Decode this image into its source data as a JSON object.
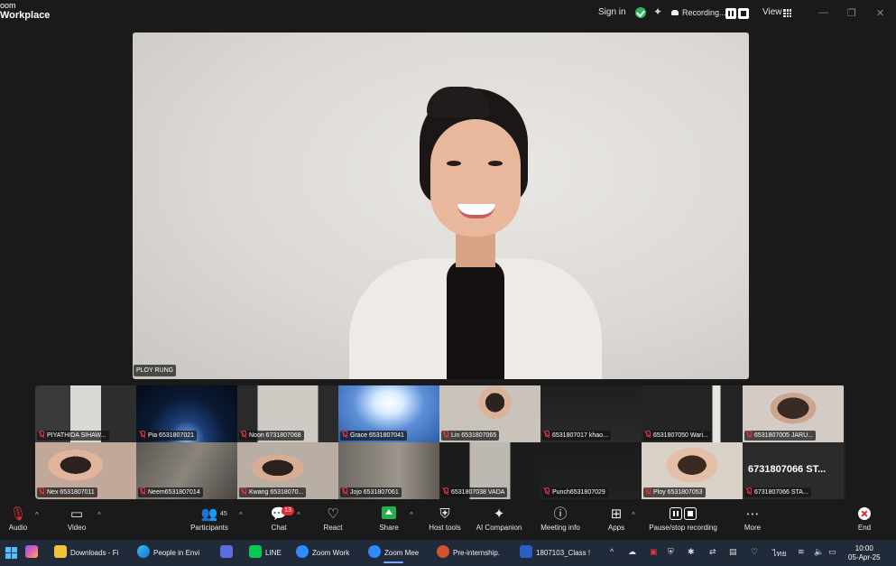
{
  "app": {
    "brand_line1": "oom",
    "brand_line2": "Workplace",
    "sign_in": "Sign in",
    "recording_label": "Recording...",
    "view_label": "View",
    "minimize": "—",
    "restore": "❐",
    "close": "✕"
  },
  "main_video": {
    "participant_name": "PLOY RUNG"
  },
  "thumbnails": [
    "PIYATHIDA SIHAW...",
    "Pia 6531807021",
    "Noon 6731807068",
    "Grace 6531807041",
    "Lin 6531807065",
    "6531807017 khao...",
    "6531807050 Wari...",
    "6531807005 JARU...",
    "Nex 6531807011",
    "Neem6531807014",
    "Kwang 65318070...",
    "Jojo 6531807061",
    "6531807038 VADA",
    "Punch6531807029",
    "Ploy 6531807053",
    "6731807066 STA..."
  ],
  "big_tile_name": "6731807066 ST...",
  "toolbar": {
    "audio": "Audio",
    "video": "Video",
    "participants": "Participants",
    "participants_count": "45",
    "chat": "Chat",
    "chat_badge": "13",
    "react": "React",
    "share": "Share",
    "host_tools": "Host tools",
    "ai_companion": "AI Companion",
    "meeting_info": "Meeting info",
    "apps": "Apps",
    "pause_stop_recording": "Pause/stop recording",
    "more": "More",
    "end": "End"
  },
  "taskbar": {
    "items": [
      "Downloads - Fi",
      "People in Envi",
      "LINE",
      "Zoom Work",
      "Zoom Mee",
      "Pre-internship.",
      "1807103_Class !"
    ],
    "language": "ไทย",
    "time": "10:00",
    "date": "05-Apr-25"
  },
  "colors": {
    "accent_green": "#21b04b",
    "badge_red": "#e02c36",
    "taskbar": "#202a39"
  }
}
